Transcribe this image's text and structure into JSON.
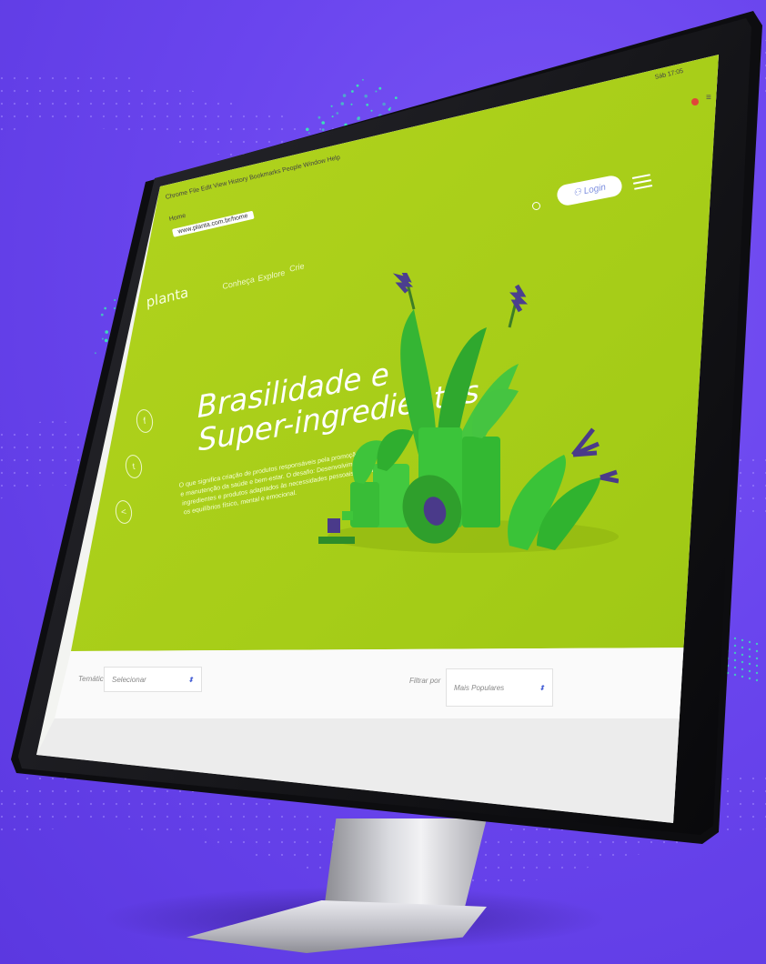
{
  "browser": {
    "menu_items": [
      "Chrome",
      "File",
      "Edit",
      "View",
      "History",
      "Bookmarks",
      "People",
      "Window",
      "Help"
    ],
    "tab_label": "Home",
    "url": "www.planta.com.br/home",
    "status_clock": "Sáb 17:05"
  },
  "site": {
    "logo": "planta",
    "nav": [
      "Conheça",
      "Explore",
      "Crie"
    ],
    "login_label": "Login",
    "hero_title_line1": "Brasilidade e",
    "hero_title_line2": "Super-ingredientes",
    "hero_description": "O que significa criação de produtos responsáveis pela promoção, prevenção e manutenção da saúde e bem-estar. O desafio: Desenvolvimento de ingredientes e produtos adaptados às necessidades pessoais para alcançar os equilíbrios físico, mental e emocional.",
    "filters": {
      "category_label": "Temática",
      "category_value": "Selecionar",
      "sort_label": "Filtrar por",
      "sort_value": "Mais Populares"
    }
  },
  "colors": {
    "background": "#6a45ee",
    "hero_green": "#a6ce18",
    "plant_green": "#3fc63a",
    "accent_purple": "#4a3a8a",
    "dots": "#3be0b8"
  }
}
